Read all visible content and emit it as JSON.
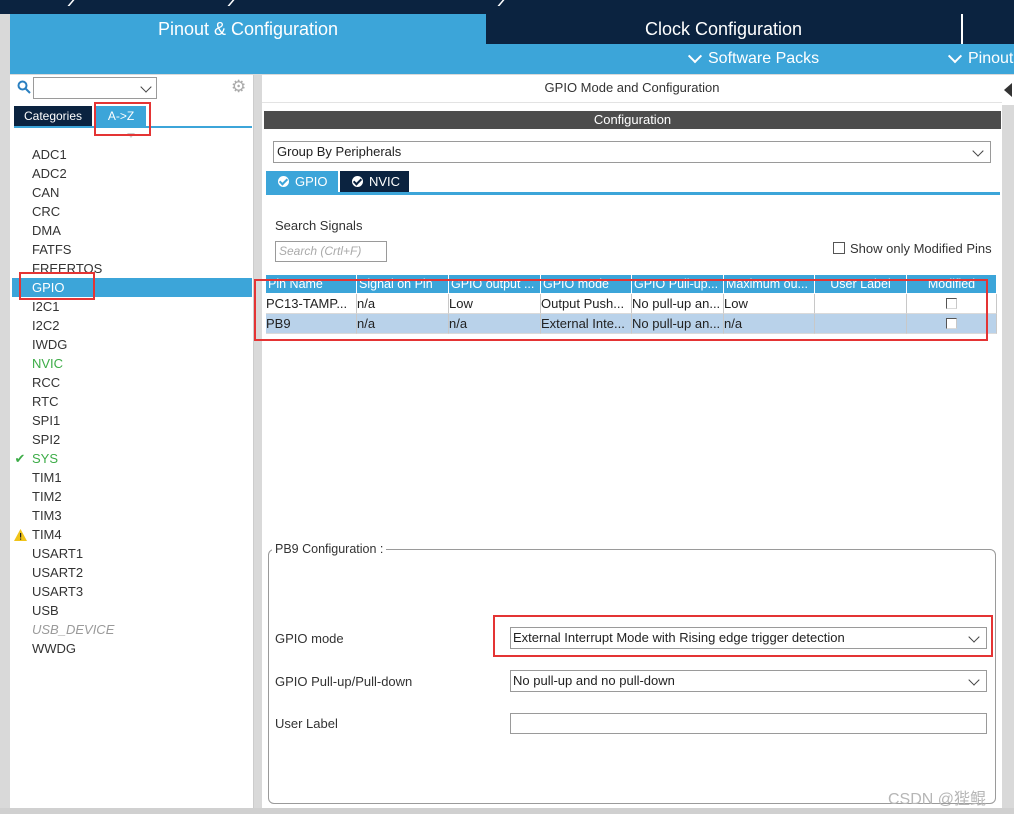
{
  "header": {
    "tab_pinout": "Pinout & Configuration",
    "tab_clock": "Clock Configuration",
    "software_packs": "Software Packs",
    "pinout": "Pinout"
  },
  "sidebar": {
    "tabs": {
      "categories": "Categories",
      "az": "A->Z"
    },
    "items": [
      {
        "label": "ADC1",
        "state": "normal"
      },
      {
        "label": "ADC2",
        "state": "normal"
      },
      {
        "label": "CAN",
        "state": "normal"
      },
      {
        "label": "CRC",
        "state": "normal"
      },
      {
        "label": "DMA",
        "state": "normal"
      },
      {
        "label": "FATFS",
        "state": "normal"
      },
      {
        "label": "FREERTOS",
        "state": "normal"
      },
      {
        "label": "GPIO",
        "state": "selected"
      },
      {
        "label": "I2C1",
        "state": "normal"
      },
      {
        "label": "I2C2",
        "state": "normal"
      },
      {
        "label": "IWDG",
        "state": "normal"
      },
      {
        "label": "NVIC",
        "state": "configured"
      },
      {
        "label": "RCC",
        "state": "normal"
      },
      {
        "label": "RTC",
        "state": "normal"
      },
      {
        "label": "SPI1",
        "state": "normal"
      },
      {
        "label": "SPI2",
        "state": "normal"
      },
      {
        "label": "SYS",
        "state": "ok"
      },
      {
        "label": "TIM1",
        "state": "normal"
      },
      {
        "label": "TIM2",
        "state": "normal"
      },
      {
        "label": "TIM3",
        "state": "normal"
      },
      {
        "label": "TIM4",
        "state": "warning"
      },
      {
        "label": "USART1",
        "state": "normal"
      },
      {
        "label": "USART2",
        "state": "normal"
      },
      {
        "label": "USART3",
        "state": "normal"
      },
      {
        "label": "USB",
        "state": "normal"
      },
      {
        "label": "USB_DEVICE",
        "state": "disabled"
      },
      {
        "label": "WWDG",
        "state": "normal"
      }
    ]
  },
  "main": {
    "title": "GPIO Mode and Configuration",
    "config_bar": "Configuration",
    "group_by": "Group By Peripherals",
    "tabs": {
      "gpio": "GPIO",
      "nvic": "NVIC"
    },
    "search_label": "Search Signals",
    "search_placeholder": "Search (Crtl+F)",
    "show_modified": "Show only Modified Pins",
    "table": {
      "headers": [
        "Pin Name",
        "Signal on Pin",
        "GPIO output ...",
        "GPIO mode",
        "GPIO Pull-up...",
        "Maximum ou...",
        "User Label",
        "Modified"
      ],
      "rows": [
        [
          "PC13-TAMP...",
          "n/a",
          "Low",
          "Output Push...",
          "No pull-up an...",
          "Low",
          "",
          false
        ],
        [
          "PB9",
          "n/a",
          "n/a",
          "External Inte...",
          "No pull-up an...",
          "n/a",
          "",
          false
        ]
      ]
    },
    "pb9": {
      "title": "PB9 Configuration :",
      "gpio_mode_label": "GPIO mode",
      "gpio_mode_value": "External Interrupt Mode with Rising edge trigger detection",
      "pull_label": "GPIO Pull-up/Pull-down",
      "pull_value": "No pull-up and no pull-down",
      "user_label": "User Label",
      "user_label_value": ""
    }
  },
  "watermark": "CSDN @狴鲲",
  "colors": {
    "accent": "#3ca5d9",
    "dark": "#0b2340",
    "highlight": "#e43434",
    "ok_green": "#3cac47"
  }
}
